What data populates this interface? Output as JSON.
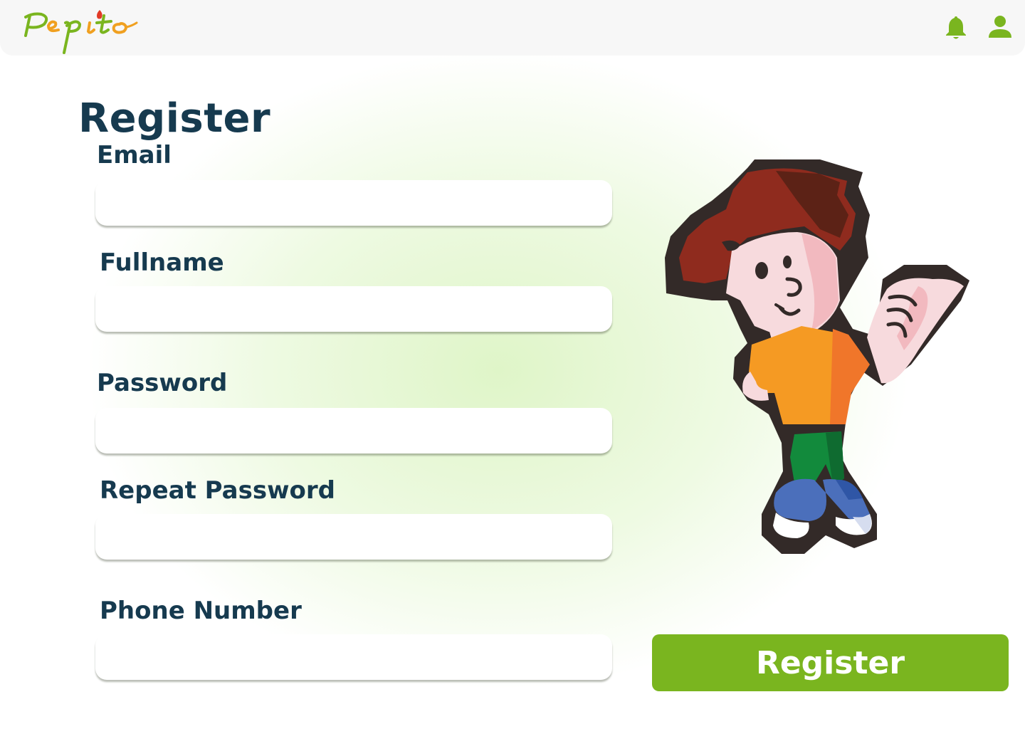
{
  "header": {
    "logo_text": "Pepito",
    "icons": [
      "bell-icon",
      "user-icon"
    ]
  },
  "form": {
    "title": "Register",
    "fields": [
      {
        "label": "Email",
        "value": "",
        "placeholder": ""
      },
      {
        "label": "Fullname",
        "value": "",
        "placeholder": ""
      },
      {
        "label": "Password",
        "value": "",
        "placeholder": ""
      },
      {
        "label": "Repeat Password",
        "value": "",
        "placeholder": ""
      },
      {
        "label": "Phone Number",
        "value": "",
        "placeholder": ""
      }
    ],
    "submit_label": "Register"
  },
  "colors": {
    "accent": "#7ab51f",
    "heading": "#163a4f",
    "header_bg": "#f7f7f7"
  }
}
